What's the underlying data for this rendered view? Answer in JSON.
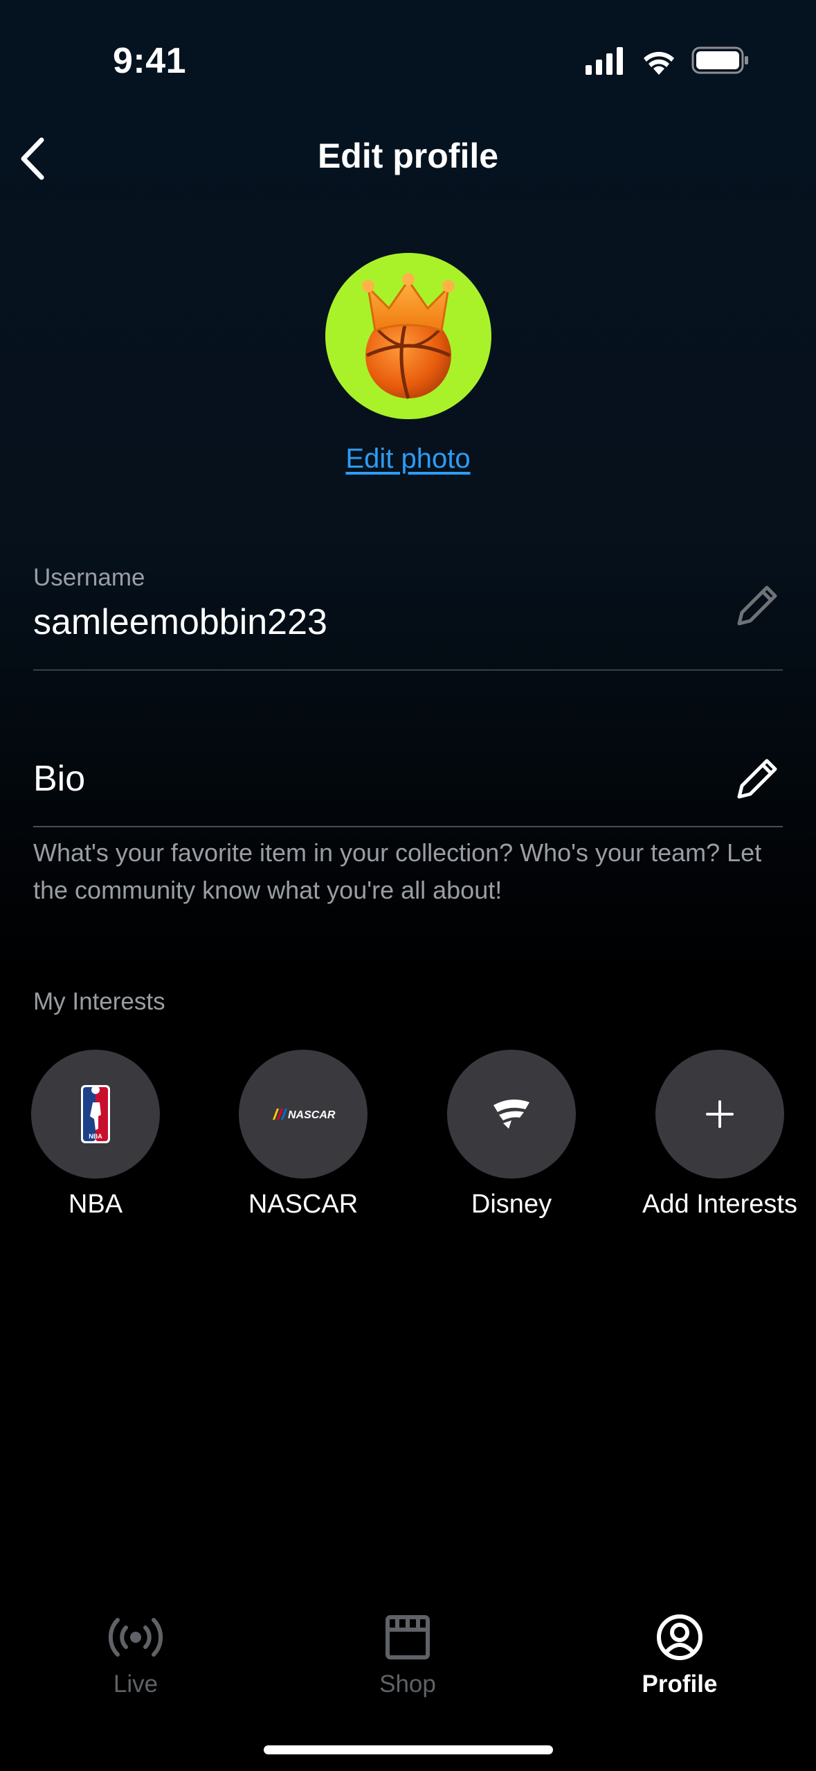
{
  "status_bar": {
    "time": "9:41"
  },
  "header": {
    "title": "Edit profile"
  },
  "avatar": {
    "edit_photo_label": "Edit photo",
    "background": "#a9f22a"
  },
  "username": {
    "label": "Username",
    "value": "samleemobbin223"
  },
  "bio": {
    "label": "Bio",
    "placeholder": "What's your favorite item in your collection? Who's your team? Let the community know what you're all about!"
  },
  "interests": {
    "label": "My Interests",
    "items": [
      {
        "name": "NBA",
        "icon": "nba-logo-icon"
      },
      {
        "name": "NASCAR",
        "icon": "nascar-logo-icon",
        "logo_text": "NASCAR"
      },
      {
        "name": "Disney",
        "icon": "fanatics-logo-icon"
      },
      {
        "name": "Add Interests",
        "icon": "plus-icon"
      }
    ]
  },
  "tab_bar": {
    "tabs": [
      {
        "label": "Live",
        "icon": "live-broadcast-icon",
        "active": false
      },
      {
        "label": "Shop",
        "icon": "storefront-icon",
        "active": false
      },
      {
        "label": "Profile",
        "icon": "user-circle-icon",
        "active": true
      }
    ]
  },
  "colors": {
    "accent_link": "#2d9cf5",
    "chip_bg": "#3a3a3e",
    "text_muted": "#9a9ea4"
  }
}
